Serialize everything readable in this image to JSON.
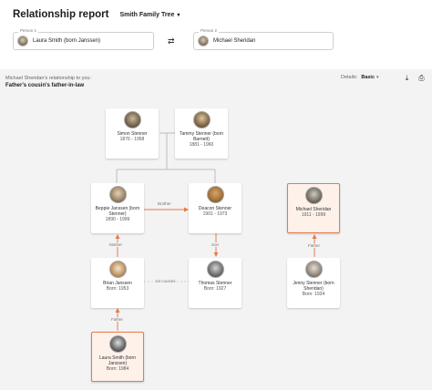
{
  "header": {
    "title": "Relationship report",
    "tree_name": "Smith Family Tree"
  },
  "person1": {
    "label": "Person 1",
    "name": "Laura Smith (born Janssen)"
  },
  "person2": {
    "label": "Person 2",
    "name": "Michael Sheridan"
  },
  "relationship": {
    "intro": "Michael Sheridan's relationship to you:",
    "result": "Father's cousin's father-in-law"
  },
  "details": {
    "label": "Details:",
    "value": "Basic"
  },
  "tools": {
    "download_icon": "download-icon",
    "print_icon": "print-icon"
  },
  "cards": {
    "simon": {
      "name": "Simon Stenner",
      "dates": "1876 - 1958"
    },
    "tammy": {
      "name": "Tammy Stenner (born Barnett)",
      "dates": "1881 - 1960"
    },
    "beppie": {
      "name": "Beppie Janssen (born Stenner)",
      "dates": "1890 - 1999"
    },
    "deacon": {
      "name": "Deacon Stenner",
      "dates": "1901 - 1973"
    },
    "michael": {
      "name": "Michael Sheridan",
      "dates": "1911 - 1999"
    },
    "brian": {
      "name": "Brian Janssen",
      "dates": "Born: 1953"
    },
    "thomas": {
      "name": "Thomas Stenner",
      "dates": "Born: 1927"
    },
    "jenny": {
      "name": "Jenny Stenner (born Sheridan)",
      "dates": "Born: 1934"
    },
    "laura": {
      "name": "Laura Smith (born Janssen)",
      "dates": "Born: 1984"
    }
  },
  "edge_labels": {
    "brother": "Brother",
    "mother": "Mother",
    "son": "Son",
    "father_jenny": "Father",
    "cousins": "1st cousins",
    "father_laura": "Father"
  },
  "colors": {
    "accent": "#e8794a",
    "canvas": "#f3f3f3",
    "line": "#bdbdbd"
  }
}
